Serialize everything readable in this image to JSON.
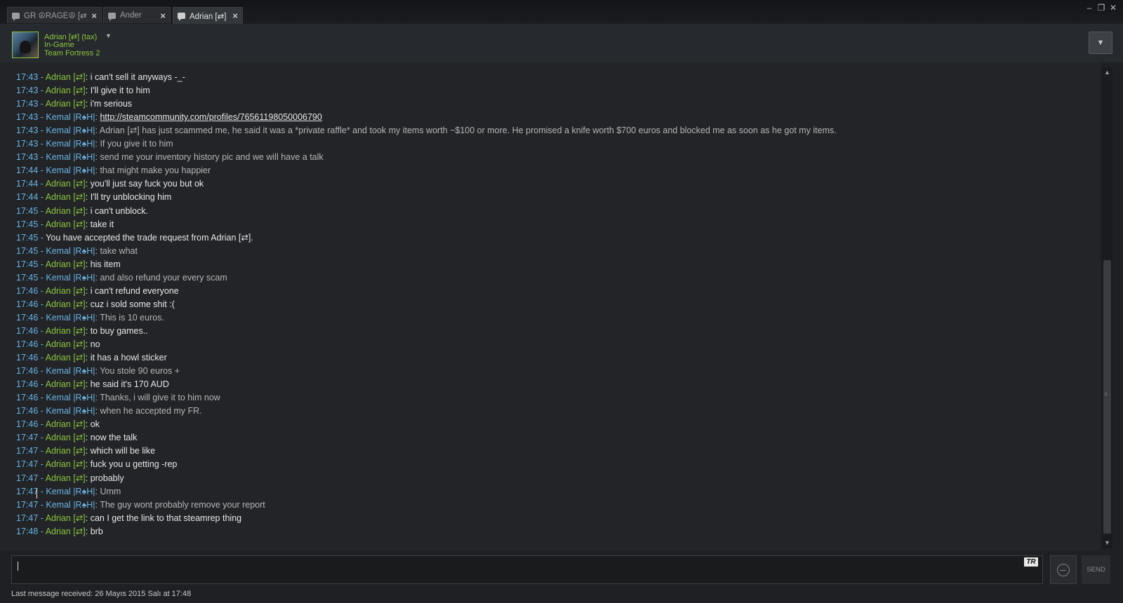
{
  "tabs": [
    {
      "label": "GR ☮RAGE☮ [⇄]",
      "close": "×"
    },
    {
      "label": "Ander",
      "close": "×"
    },
    {
      "label": "Adrian [⇄]",
      "close": "×"
    }
  ],
  "window_buttons": {
    "minimize": "–",
    "maximize": "❐",
    "close": "✕"
  },
  "header": {
    "name": "Adrian  [⇄] (tax)",
    "caret": "▼",
    "status": "In-Game",
    "game": "Team Fortress 2",
    "options_icon": "▼"
  },
  "messages": [
    {
      "time": "17:43",
      "sender": "Adrian  [⇄]",
      "text": "i can't sell it anyways -_-"
    },
    {
      "time": "17:43",
      "sender": "Adrian  [⇄]",
      "text": "I'll give it to him"
    },
    {
      "time": "17:43",
      "sender": "Adrian  [⇄]",
      "text": "i'm serious"
    },
    {
      "time": "17:43",
      "sender": "Kemal |R♠H|",
      "text": "http://steamcommunity.com/profiles/76561198050006790"
    },
    {
      "time": "17:43",
      "sender": "Kemal |R♠H|",
      "text": "Adrian [⇄] has just scammed me, he said it was a *private raffle* and took my items worth ~$100 or more. He promised a knife worth $700 euros and blocked me as soon as he got my items."
    },
    {
      "time": "17:43",
      "sender": "Kemal |R♠H|",
      "text": "If you give it to him"
    },
    {
      "time": "17:43",
      "sender": "Kemal |R♠H|",
      "text": "send me your inventory history pic and we will have a talk"
    },
    {
      "time": "17:44",
      "sender": "Kemal |R♠H|",
      "text": "that might make you happier"
    },
    {
      "time": "17:44",
      "sender": "Adrian  [⇄]",
      "text": "you'll just say fuck you but ok"
    },
    {
      "time": "17:44",
      "sender": "Adrian  [⇄]",
      "text": "I'll try unblocking him"
    },
    {
      "time": "17:45",
      "sender": "Adrian  [⇄]",
      "text": "i can't unblock."
    },
    {
      "time": "17:45",
      "sender": "Adrian  [⇄]",
      "text": "take it"
    },
    {
      "time": "17:45",
      "sender": "",
      "text": "You have accepted the trade request from Adrian  [⇄]."
    },
    {
      "time": "17:45",
      "sender": "Kemal |R♠H|",
      "text": "take what"
    },
    {
      "time": "17:45",
      "sender": "Adrian  [⇄]",
      "text": "his item"
    },
    {
      "time": "17:45",
      "sender": "Kemal |R♠H|",
      "text": "and also refund your every scam"
    },
    {
      "time": "17:46",
      "sender": "Adrian  [⇄]",
      "text": "i can't refund everyone"
    },
    {
      "time": "17:46",
      "sender": "Adrian  [⇄]",
      "text": "cuz i sold some shit :("
    },
    {
      "time": "17:46",
      "sender": "Kemal |R♠H|",
      "text": "This is 10 euros."
    },
    {
      "time": "17:46",
      "sender": "Adrian  [⇄]",
      "text": "to buy games.."
    },
    {
      "time": "17:46",
      "sender": "Adrian  [⇄]",
      "text": "no"
    },
    {
      "time": "17:46",
      "sender": "Adrian  [⇄]",
      "text": "it has a howl sticker"
    },
    {
      "time": "17:46",
      "sender": "Kemal |R♠H|",
      "text": "You stole 90 euros +"
    },
    {
      "time": "17:46",
      "sender": "Adrian  [⇄]",
      "text": "he said it's 170 AUD"
    },
    {
      "time": "17:46",
      "sender": "Kemal |R♠H|",
      "text": "Thanks, i will give it to him now"
    },
    {
      "time": "17:46",
      "sender": "Kemal |R♠H|",
      "text": "when he accepted my FR."
    },
    {
      "time": "17:46",
      "sender": "Adrian  [⇄]",
      "text": "ok"
    },
    {
      "time": "17:47",
      "sender": "Adrian  [⇄]",
      "text": "now the talk"
    },
    {
      "time": "17:47",
      "sender": "Adrian  [⇄]",
      "text": "which will be like"
    },
    {
      "time": "17:47",
      "sender": "Adrian  [⇄]",
      "text": "fuck you u getting -rep"
    },
    {
      "time": "17:47",
      "sender": "Adrian  [⇄]",
      "text": "probably"
    },
    {
      "time": "17:47",
      "sender": "Kemal |R♠H|",
      "text": "Umm"
    },
    {
      "time": "17:47",
      "sender": "Kemal |R♠H|",
      "text": "The guy wont probably remove your report"
    },
    {
      "time": "17:47",
      "sender": "Adrian  [⇄]",
      "text": "can I get the link to that steamrep thing"
    },
    {
      "time": "17:48",
      "sender": "Adrian  [⇄]",
      "text": "brb"
    }
  ],
  "input": {
    "value": "",
    "placeholder": "",
    "tr_badge": "TR"
  },
  "send_label": "SEND",
  "status": "Last message received: 26 Mayıs 2015 Salı at 17:48",
  "colors": {
    "adrian": "#8bc53f",
    "kemal": "#6ab3e3",
    "timestamp": "#6ab3e3",
    "background": "#222427"
  }
}
